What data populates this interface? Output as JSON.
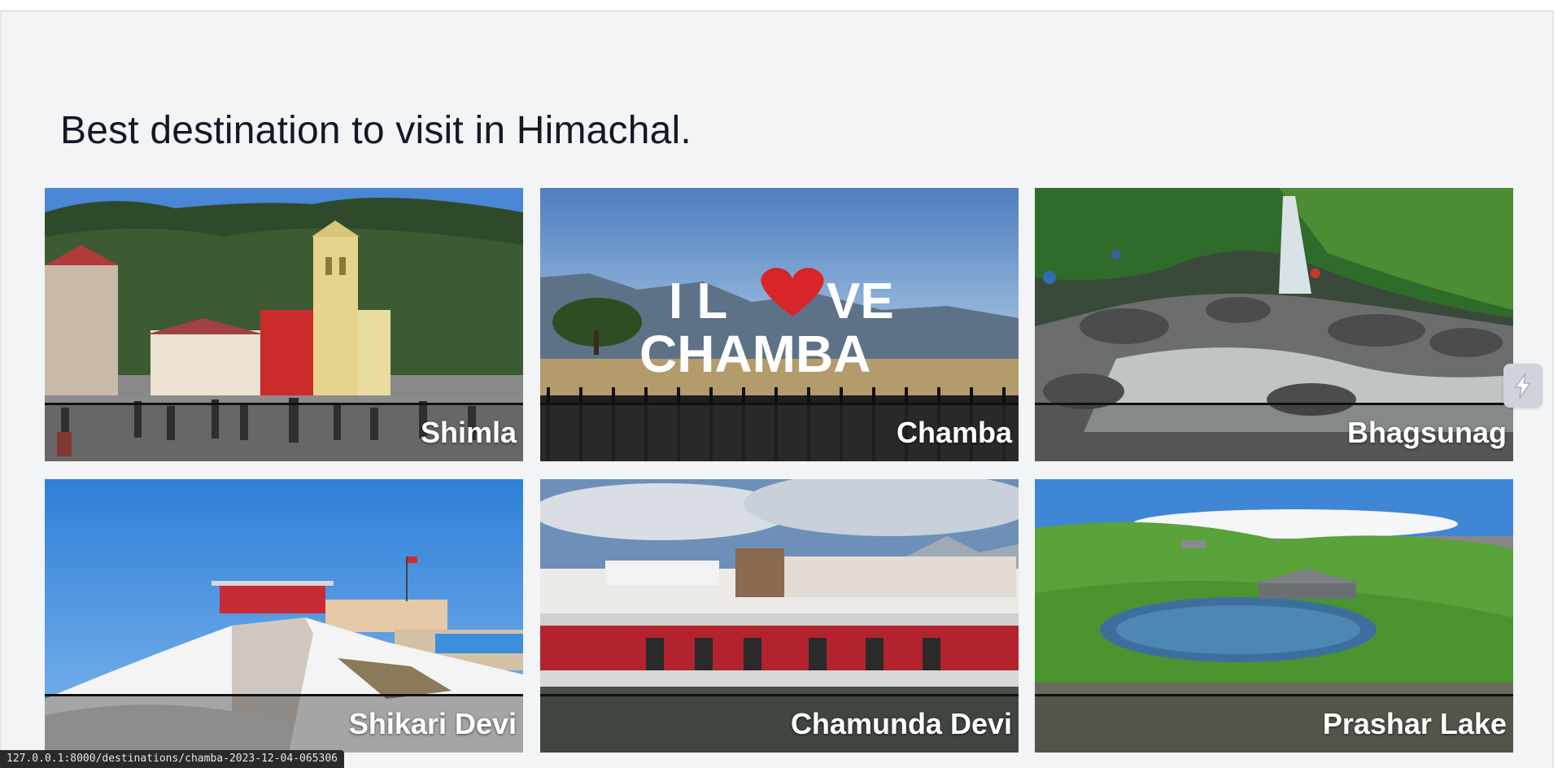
{
  "heading": "Best destination to visit in Himachal.",
  "cards": [
    {
      "label": "Shimla"
    },
    {
      "label": "Chamba"
    },
    {
      "label": "Bhagsunag"
    },
    {
      "label": "Shikari Devi"
    },
    {
      "label": "Chamunda Devi"
    },
    {
      "label": "Prashar Lake"
    }
  ],
  "chamba_sign": {
    "line1_a": "I L",
    "line1_b": "VE",
    "line2": "CHAMBA"
  },
  "status_url": "127.0.0.1:8000/destinations/chamba-2023-12-04-065306",
  "icons": {
    "side_handle": "lightning-icon",
    "heart": "heart-icon"
  }
}
